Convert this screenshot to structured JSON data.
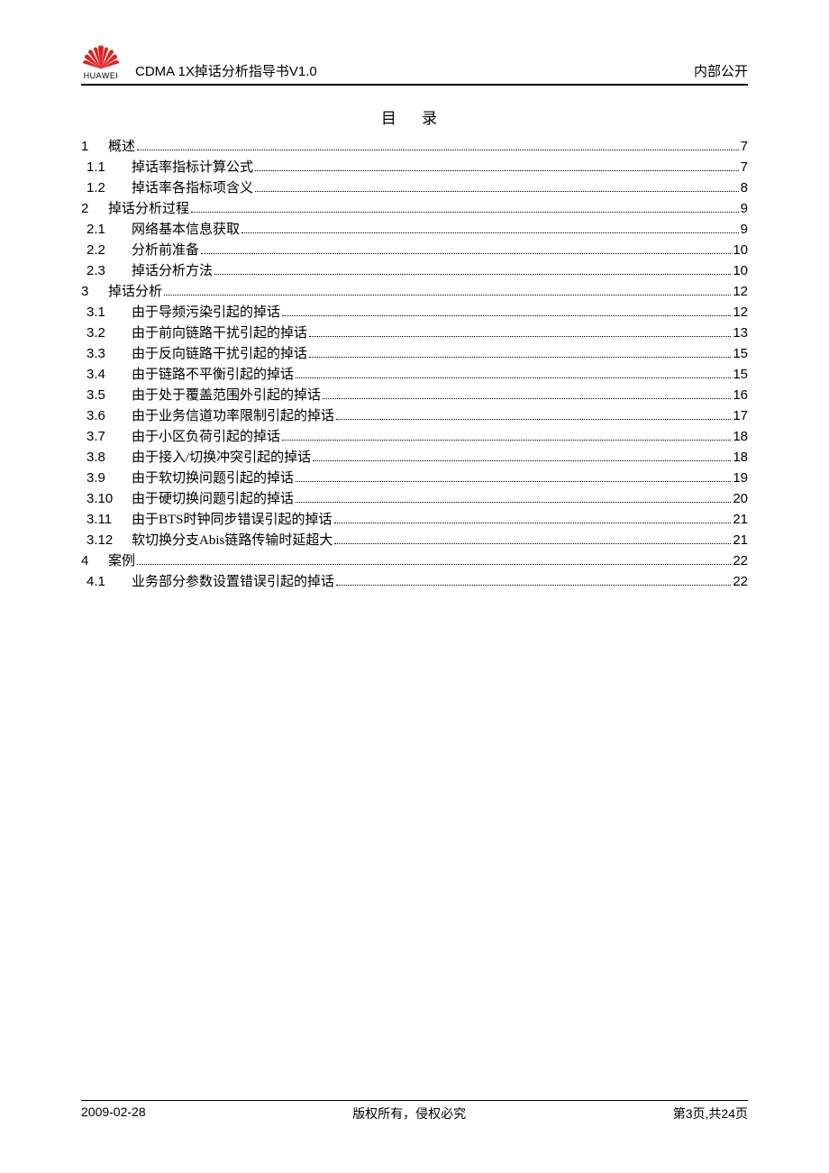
{
  "header": {
    "brand": "HUAWEI",
    "doc_title": "CDMA 1X掉话分析指导书V1.0",
    "classification": "内部公开"
  },
  "toc_title": "目  录",
  "toc": [
    {
      "level": 1,
      "num": "1",
      "text": "概述",
      "page": "7"
    },
    {
      "level": 2,
      "num": "1.1",
      "text": "掉话率指标计算公式",
      "page": "7"
    },
    {
      "level": 2,
      "num": "1.2",
      "text": "掉话率各指标项含义",
      "page": "8"
    },
    {
      "level": 1,
      "num": "2",
      "text": "掉话分析过程",
      "page": "9"
    },
    {
      "level": 2,
      "num": "2.1",
      "text": "网络基本信息获取",
      "page": "9"
    },
    {
      "level": 2,
      "num": "2.2",
      "text": "分析前准备",
      "page": "10"
    },
    {
      "level": 2,
      "num": "2.3",
      "text": "掉话分析方法",
      "page": "10"
    },
    {
      "level": 1,
      "num": "3",
      "text": "掉话分析",
      "page": "12"
    },
    {
      "level": 2,
      "num": "3.1",
      "text": "由于导频污染引起的掉话",
      "page": "12"
    },
    {
      "level": 2,
      "num": "3.2",
      "text": "由于前向链路干扰引起的掉话",
      "page": "13"
    },
    {
      "level": 2,
      "num": "3.3",
      "text": "由于反向链路干扰引起的掉话",
      "page": "15"
    },
    {
      "level": 2,
      "num": "3.4",
      "text": "由于链路不平衡引起的掉话",
      "page": "15"
    },
    {
      "level": 2,
      "num": "3.5",
      "text": "由于处于覆盖范围外引起的掉话",
      "page": "16"
    },
    {
      "level": 2,
      "num": "3.6",
      "text": "由于业务信道功率限制引起的掉话",
      "page": "17"
    },
    {
      "level": 2,
      "num": "3.7",
      "text": "由于小区负荷引起的掉话",
      "page": "18"
    },
    {
      "level": 2,
      "num": "3.8",
      "text": "由于接入/切换冲突引起的掉话",
      "page": "18"
    },
    {
      "level": 2,
      "num": "3.9",
      "text": "由于软切换问题引起的掉话",
      "page": "19"
    },
    {
      "level": 2,
      "num": "3.10",
      "text": "由于硬切换问题引起的掉话",
      "page": "20"
    },
    {
      "level": 2,
      "num": "3.11",
      "text": "由于BTS时钟同步错误引起的掉话",
      "page": "21"
    },
    {
      "level": 2,
      "num": "3.12",
      "text": "软切换分支Abis链路传输时延超大",
      "page": "21"
    },
    {
      "level": 1,
      "num": "4",
      "text": "案例",
      "page": "22"
    },
    {
      "level": 2,
      "num": "4.1",
      "text": "业务部分参数设置错误引起的掉话",
      "page": "22"
    }
  ],
  "footer": {
    "date": "2009-02-28",
    "copyright": "版权所有，侵权必究",
    "page_info": "第3页,共24页"
  }
}
